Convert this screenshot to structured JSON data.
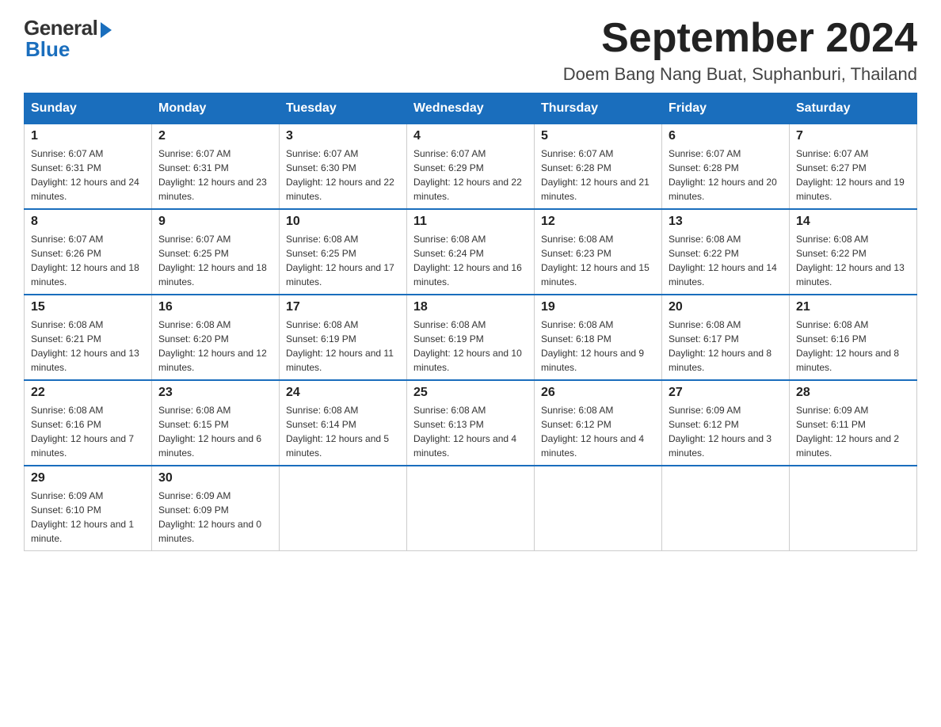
{
  "logo": {
    "general": "General",
    "blue": "Blue"
  },
  "title": {
    "month_year": "September 2024",
    "location": "Doem Bang Nang Buat, Suphanburi, Thailand"
  },
  "days_of_week": [
    "Sunday",
    "Monday",
    "Tuesday",
    "Wednesday",
    "Thursday",
    "Friday",
    "Saturday"
  ],
  "weeks": [
    [
      {
        "day": "1",
        "sunrise": "6:07 AM",
        "sunset": "6:31 PM",
        "daylight": "12 hours and 24 minutes."
      },
      {
        "day": "2",
        "sunrise": "6:07 AM",
        "sunset": "6:31 PM",
        "daylight": "12 hours and 23 minutes."
      },
      {
        "day": "3",
        "sunrise": "6:07 AM",
        "sunset": "6:30 PM",
        "daylight": "12 hours and 22 minutes."
      },
      {
        "day": "4",
        "sunrise": "6:07 AM",
        "sunset": "6:29 PM",
        "daylight": "12 hours and 22 minutes."
      },
      {
        "day": "5",
        "sunrise": "6:07 AM",
        "sunset": "6:28 PM",
        "daylight": "12 hours and 21 minutes."
      },
      {
        "day": "6",
        "sunrise": "6:07 AM",
        "sunset": "6:28 PM",
        "daylight": "12 hours and 20 minutes."
      },
      {
        "day": "7",
        "sunrise": "6:07 AM",
        "sunset": "6:27 PM",
        "daylight": "12 hours and 19 minutes."
      }
    ],
    [
      {
        "day": "8",
        "sunrise": "6:07 AM",
        "sunset": "6:26 PM",
        "daylight": "12 hours and 18 minutes."
      },
      {
        "day": "9",
        "sunrise": "6:07 AM",
        "sunset": "6:25 PM",
        "daylight": "12 hours and 18 minutes."
      },
      {
        "day": "10",
        "sunrise": "6:08 AM",
        "sunset": "6:25 PM",
        "daylight": "12 hours and 17 minutes."
      },
      {
        "day": "11",
        "sunrise": "6:08 AM",
        "sunset": "6:24 PM",
        "daylight": "12 hours and 16 minutes."
      },
      {
        "day": "12",
        "sunrise": "6:08 AM",
        "sunset": "6:23 PM",
        "daylight": "12 hours and 15 minutes."
      },
      {
        "day": "13",
        "sunrise": "6:08 AM",
        "sunset": "6:22 PM",
        "daylight": "12 hours and 14 minutes."
      },
      {
        "day": "14",
        "sunrise": "6:08 AM",
        "sunset": "6:22 PM",
        "daylight": "12 hours and 13 minutes."
      }
    ],
    [
      {
        "day": "15",
        "sunrise": "6:08 AM",
        "sunset": "6:21 PM",
        "daylight": "12 hours and 13 minutes."
      },
      {
        "day": "16",
        "sunrise": "6:08 AM",
        "sunset": "6:20 PM",
        "daylight": "12 hours and 12 minutes."
      },
      {
        "day": "17",
        "sunrise": "6:08 AM",
        "sunset": "6:19 PM",
        "daylight": "12 hours and 11 minutes."
      },
      {
        "day": "18",
        "sunrise": "6:08 AM",
        "sunset": "6:19 PM",
        "daylight": "12 hours and 10 minutes."
      },
      {
        "day": "19",
        "sunrise": "6:08 AM",
        "sunset": "6:18 PM",
        "daylight": "12 hours and 9 minutes."
      },
      {
        "day": "20",
        "sunrise": "6:08 AM",
        "sunset": "6:17 PM",
        "daylight": "12 hours and 8 minutes."
      },
      {
        "day": "21",
        "sunrise": "6:08 AM",
        "sunset": "6:16 PM",
        "daylight": "12 hours and 8 minutes."
      }
    ],
    [
      {
        "day": "22",
        "sunrise": "6:08 AM",
        "sunset": "6:16 PM",
        "daylight": "12 hours and 7 minutes."
      },
      {
        "day": "23",
        "sunrise": "6:08 AM",
        "sunset": "6:15 PM",
        "daylight": "12 hours and 6 minutes."
      },
      {
        "day": "24",
        "sunrise": "6:08 AM",
        "sunset": "6:14 PM",
        "daylight": "12 hours and 5 minutes."
      },
      {
        "day": "25",
        "sunrise": "6:08 AM",
        "sunset": "6:13 PM",
        "daylight": "12 hours and 4 minutes."
      },
      {
        "day": "26",
        "sunrise": "6:08 AM",
        "sunset": "6:12 PM",
        "daylight": "12 hours and 4 minutes."
      },
      {
        "day": "27",
        "sunrise": "6:09 AM",
        "sunset": "6:12 PM",
        "daylight": "12 hours and 3 minutes."
      },
      {
        "day": "28",
        "sunrise": "6:09 AM",
        "sunset": "6:11 PM",
        "daylight": "12 hours and 2 minutes."
      }
    ],
    [
      {
        "day": "29",
        "sunrise": "6:09 AM",
        "sunset": "6:10 PM",
        "daylight": "12 hours and 1 minute."
      },
      {
        "day": "30",
        "sunrise": "6:09 AM",
        "sunset": "6:09 PM",
        "daylight": "12 hours and 0 minutes."
      },
      null,
      null,
      null,
      null,
      null
    ]
  ]
}
